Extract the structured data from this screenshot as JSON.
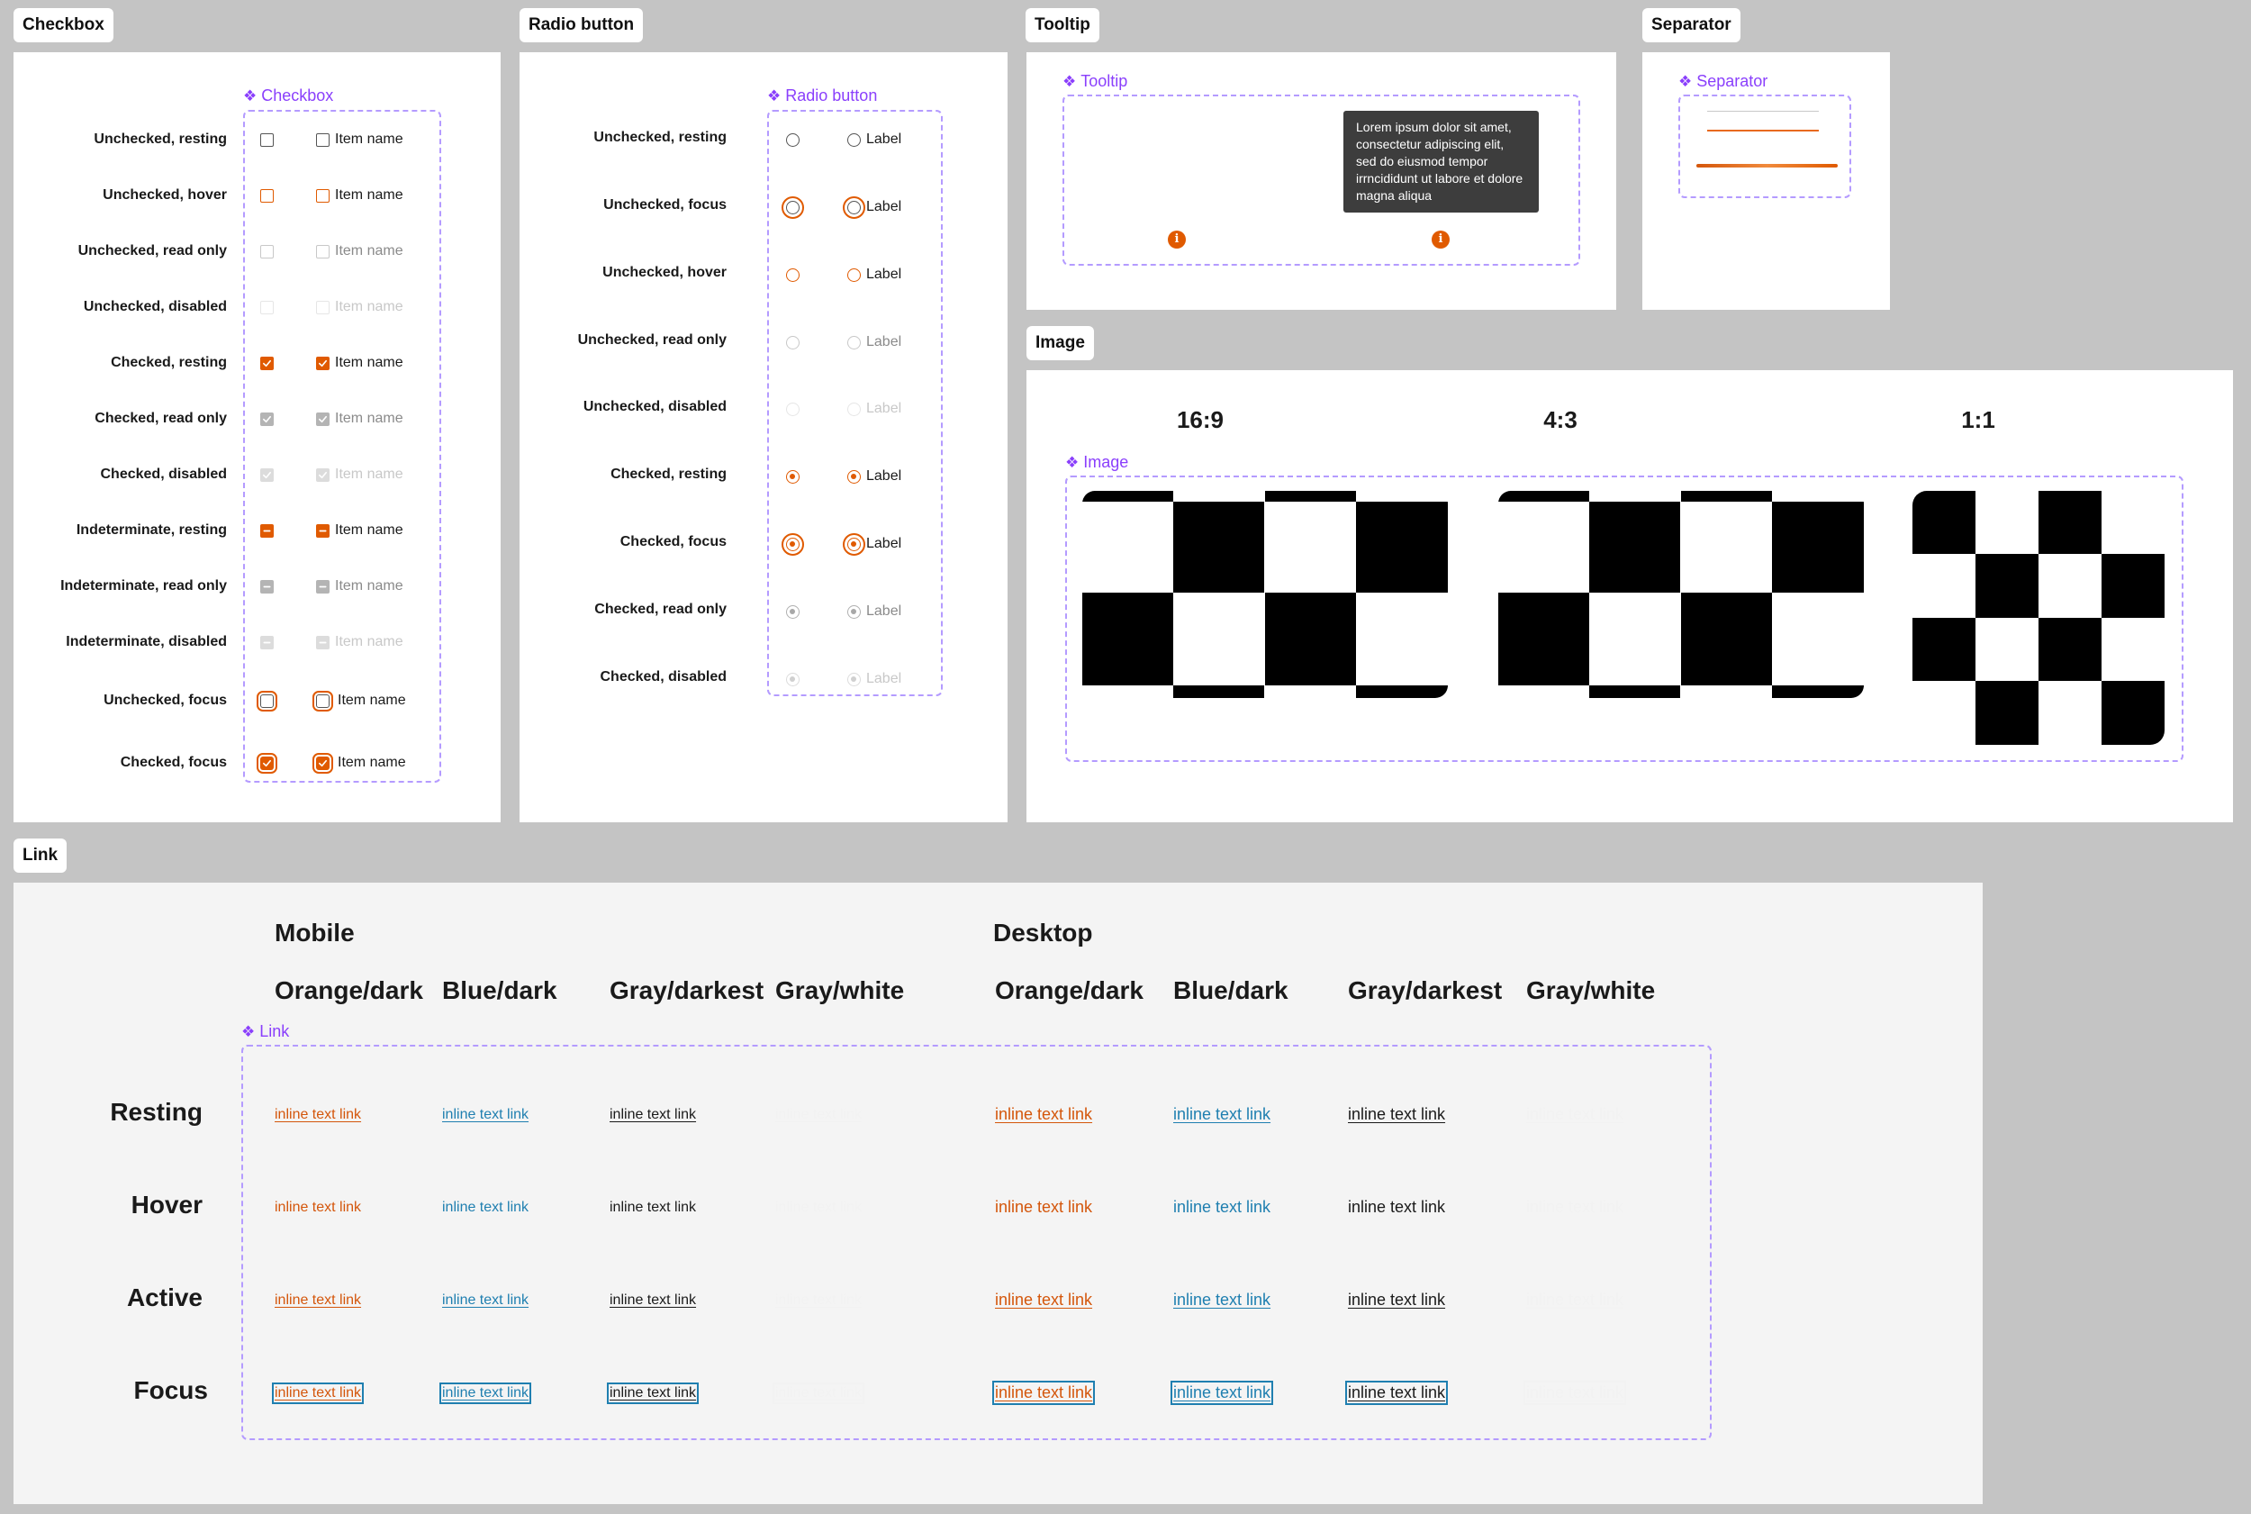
{
  "sections": {
    "checkbox": "Checkbox",
    "radio": "Radio button",
    "tooltip": "Tooltip",
    "separator": "Separator",
    "image": "Image",
    "link": "Link"
  },
  "component_labels": {
    "checkbox": "Checkbox",
    "radio": "Radio button",
    "tooltip": "Tooltip",
    "separator": "Separator",
    "image": "Image",
    "link": "Link"
  },
  "checkbox": {
    "item_label": "Item name",
    "rows": [
      {
        "label": "Unchecked, resting",
        "state": "un-rest"
      },
      {
        "label": "Unchecked, hover",
        "state": "un-hover"
      },
      {
        "label": "Unchecked, read only",
        "state": "un-ro"
      },
      {
        "label": "Unchecked, disabled",
        "state": "un-dis"
      },
      {
        "label": "Checked, resting",
        "state": "ch-rest"
      },
      {
        "label": "Checked, read only",
        "state": "ch-ro"
      },
      {
        "label": "Checked, disabled",
        "state": "ch-dis"
      },
      {
        "label": "Indeterminate, resting",
        "state": "ind-rest"
      },
      {
        "label": "Indeterminate, read only",
        "state": "ind-ro"
      },
      {
        "label": "Indeterminate, disabled",
        "state": "ind-dis"
      },
      {
        "label": "Unchecked, focus",
        "state": "un-focus"
      },
      {
        "label": "Checked, focus",
        "state": "ch-focus"
      }
    ]
  },
  "radio": {
    "item_label": "Label",
    "rows": [
      {
        "label": "Unchecked, resting",
        "state": "un-rest"
      },
      {
        "label": "Unchecked, focus",
        "state": "un-focus"
      },
      {
        "label": "Unchecked, hover",
        "state": "un-hover"
      },
      {
        "label": "Unchecked,  read only",
        "state": "un-ro"
      },
      {
        "label": "Unchecked,  disabled",
        "state": "un-dis"
      },
      {
        "label": "Checked,  resting",
        "state": "ch-rest"
      },
      {
        "label": "Checked, focus",
        "state": "ch-focus"
      },
      {
        "label": "Checked,  read only",
        "state": "ch-ro"
      },
      {
        "label": "Checked,  disabled",
        "state": "ch-dis"
      }
    ]
  },
  "tooltip": {
    "text": "Lorem ipsum dolor sit amet, consectetur adipiscing elit, sed do eiusmod tempor irrncididunt ut labore et dolore magna aliqua",
    "icon": "info-icon"
  },
  "image": {
    "ratios": [
      "16:9",
      "4:3",
      "1:1"
    ]
  },
  "link": {
    "groups": [
      "Mobile",
      "Desktop"
    ],
    "columns": [
      "Orange/dark",
      "Blue/dark",
      "Gray/darkest",
      "Gray/white",
      "Orange/dark",
      "Blue/dark",
      "Gray/darkest",
      "Gray/white"
    ],
    "states": [
      "Resting",
      "Hover",
      "Active",
      "Focus"
    ],
    "link_text": "inline text link"
  },
  "colors": {
    "accent_orange": "#e05a00",
    "link_orange": "#d4560b",
    "link_blue": "#1f7fb0",
    "component_purple": "#8a3ffc",
    "tooltip_bg": "#3d3d3d",
    "canvas": "#c4c4c4"
  }
}
